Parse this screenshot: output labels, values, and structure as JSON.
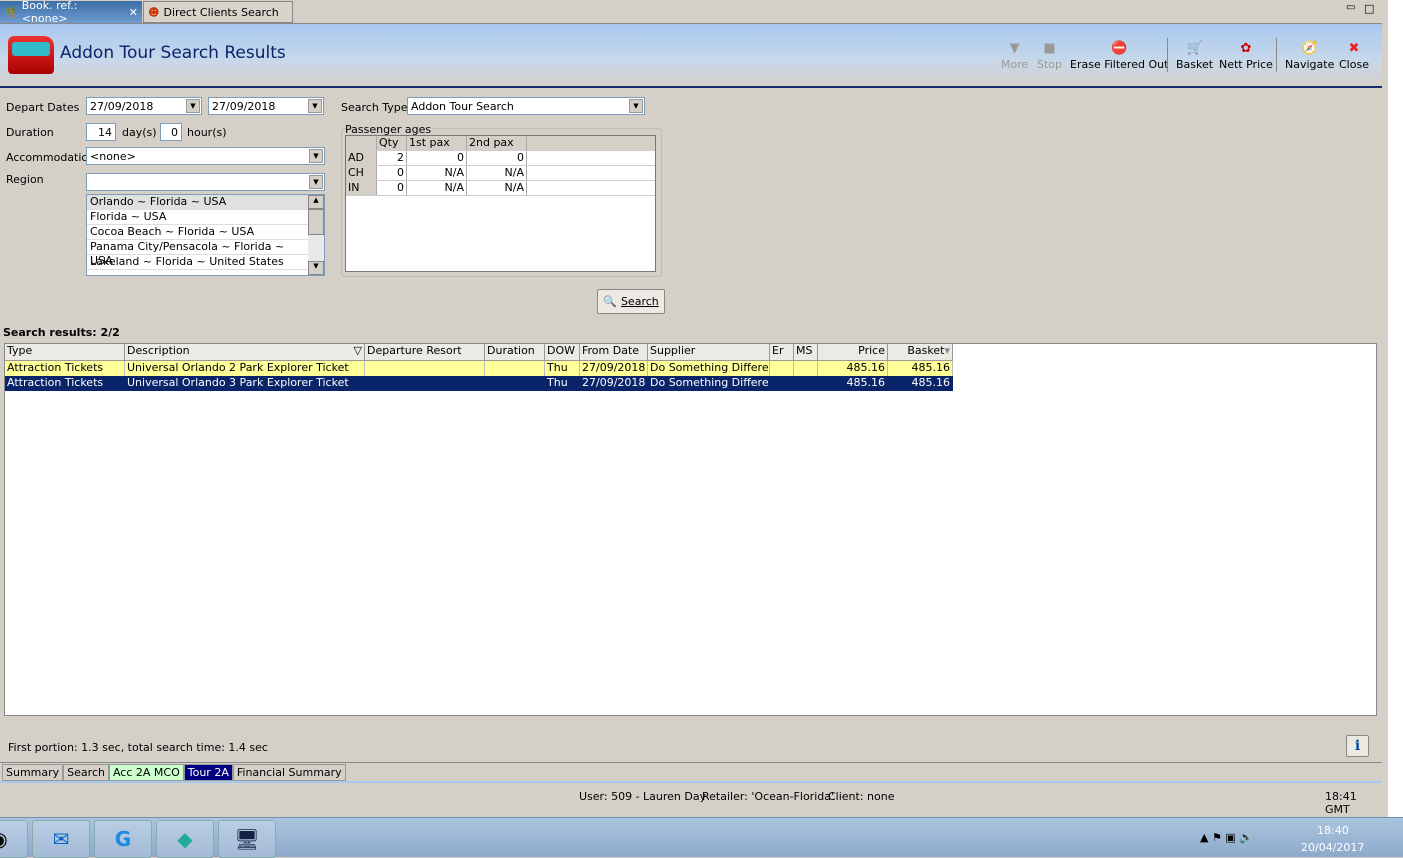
{
  "tabs": [
    {
      "label": "Book. ref.: <none>"
    },
    {
      "label": "Direct Clients Search"
    }
  ],
  "header": {
    "title": "Addon Tour Search Results"
  },
  "toolbar": {
    "more": "More",
    "stop": "Stop",
    "erase": "Erase Filtered Out",
    "basket": "Basket",
    "nett": "Nett Price",
    "navigate": "Navigate",
    "close": "Close"
  },
  "form": {
    "depart_label": "Depart Dates",
    "depart_from": "27/09/2018",
    "depart_to": "27/09/2018",
    "duration_label": "Duration",
    "days": "14",
    "days_unit": "day(s)",
    "hours": "0",
    "hours_unit": "hour(s)",
    "accom_label": "Accommodation",
    "accom": "<none>",
    "region_label": "Region",
    "region": "",
    "regions": [
      "Orlando ~ Florida ~ USA",
      "Florida ~ USA",
      "Cocoa Beach ~ Florida ~ USA",
      "Panama City/Pensacola ~  Florida  ~ USA",
      "Lakeland ~ Florida ~ United States"
    ],
    "search_type_label": "Search Type",
    "search_type": "Addon Tour Search",
    "pax_label": "Passenger ages",
    "pax_headers": [
      "",
      "Qty",
      "1st pax",
      "2nd pax"
    ],
    "pax_rows": [
      [
        "AD",
        "2",
        "0",
        "0"
      ],
      [
        "CH",
        "0",
        "N/A",
        "N/A"
      ],
      [
        "IN",
        "0",
        "N/A",
        "N/A"
      ]
    ],
    "search_button": "Search"
  },
  "results": {
    "label": "Search results: 2/2",
    "columns": [
      "Type",
      "Description",
      "Departure Resort",
      "Duration",
      "DOW",
      "From Date",
      "Supplier",
      "Er",
      "MS",
      "Price",
      "Basket"
    ],
    "rows": [
      [
        "Attraction Tickets",
        "Universal Orlando 2 Park Explorer Ticket",
        "",
        "",
        "Thu",
        "27/09/2018",
        "Do Something Different",
        "",
        "",
        "485.16",
        "485.16"
      ],
      [
        "Attraction Tickets",
        "Universal Orlando 3 Park Explorer Ticket",
        "",
        "",
        "Thu",
        "27/09/2018",
        "Do Something Different",
        "",
        "",
        "485.16",
        "485.16"
      ]
    ]
  },
  "timing": "First portion: 1.3 sec, total search time: 1.4 sec",
  "bottom_tabs": [
    "Summary",
    "Search",
    "Acc 2A MCO",
    "Tour 2A",
    "Financial Summary"
  ],
  "status": {
    "user": "User: 509 - Lauren Day",
    "retailer": "Retailer: 'Ocean-Florida'",
    "client": "Client: none",
    "time": "18:41 GMT"
  },
  "taskbar": {
    "time": "18:40",
    "date": "20/04/2017"
  },
  "info_button": "i"
}
